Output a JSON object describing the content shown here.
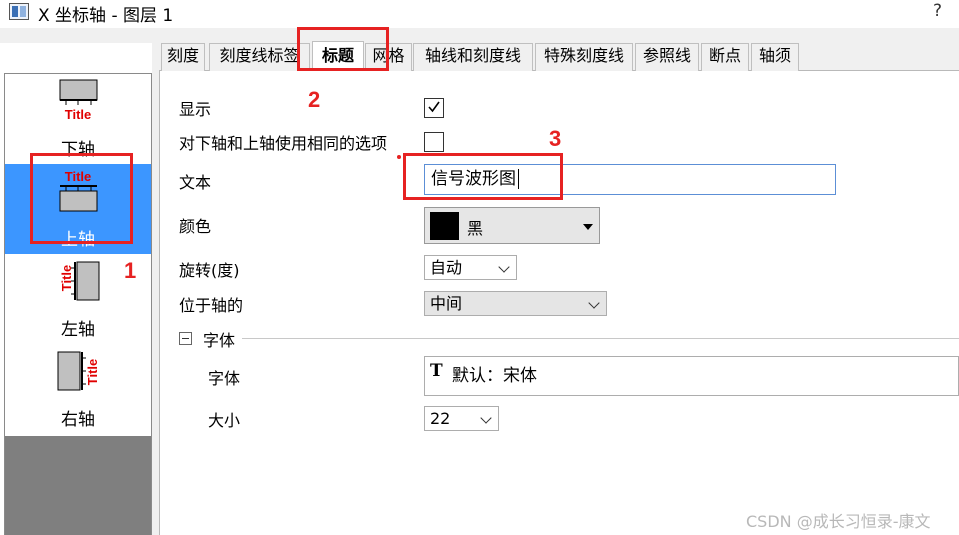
{
  "window": {
    "title": "X 坐标轴 - 图层 1",
    "help": "?"
  },
  "axes": [
    {
      "label": "下轴",
      "icon": "bottom-axis-icon",
      "icon_text": "Title"
    },
    {
      "label": "上轴",
      "icon": "top-axis-icon",
      "icon_text": "Title"
    },
    {
      "label": "左轴",
      "icon": "left-axis-icon",
      "icon_text": "Title"
    },
    {
      "label": "右轴",
      "icon": "right-axis-icon",
      "icon_text": "Title"
    }
  ],
  "tabs": [
    "刻度",
    "刻度线标签",
    "标题",
    "网格",
    "轴线和刻度线",
    "特殊刻度线",
    "参照线",
    "断点",
    "轴须"
  ],
  "active_tab": "标题",
  "form": {
    "show_label": "显示",
    "show_checked": true,
    "same_options_label": "对下轴和上轴使用相同的选项",
    "same_options_checked": false,
    "text_label": "文本",
    "text_value": "信号波形图",
    "color_label": "颜色",
    "color_value": "黑",
    "color_hex": "#000000",
    "rotation_label": "旋转(度)",
    "rotation_value": "自动",
    "position_label": "位于轴的",
    "position_value": "中间",
    "font_group_label": "字体",
    "font_label": "字体",
    "font_value": "默认：宋体",
    "size_label": "大小",
    "size_value": "22"
  },
  "annotations": {
    "n1": "1",
    "n2": "2",
    "n3": "3",
    "color": "#e62222"
  },
  "watermark": "CSDN @成长习恒录-康文"
}
